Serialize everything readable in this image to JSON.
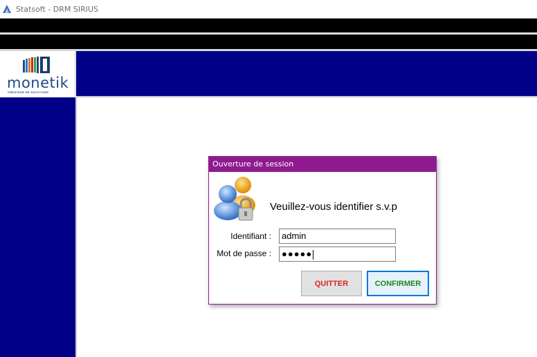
{
  "window": {
    "title": "Statsoft - DRM SIRIUS"
  },
  "logo": {
    "name": "monetik",
    "tagline": "CRÉATEUR DE SOLUTIONS"
  },
  "dialog": {
    "title": "Ouverture de session",
    "prompt": "Veuillez-vous identifier s.v.p",
    "username_label": "Identifiant :",
    "username_value": "admin",
    "password_label": "Mot de passe :",
    "password_value": "●●●●●",
    "quit_label": "QUITTER",
    "confirm_label": "CONFIRMER"
  },
  "colors": {
    "app_blue": "#000088",
    "dialog_accent": "#8e1a8e",
    "quit_text": "#e02020",
    "confirm_text": "#1a8a1a"
  },
  "icons": {
    "app": "statsoft-app-icon",
    "users": "users-lock-icon"
  }
}
